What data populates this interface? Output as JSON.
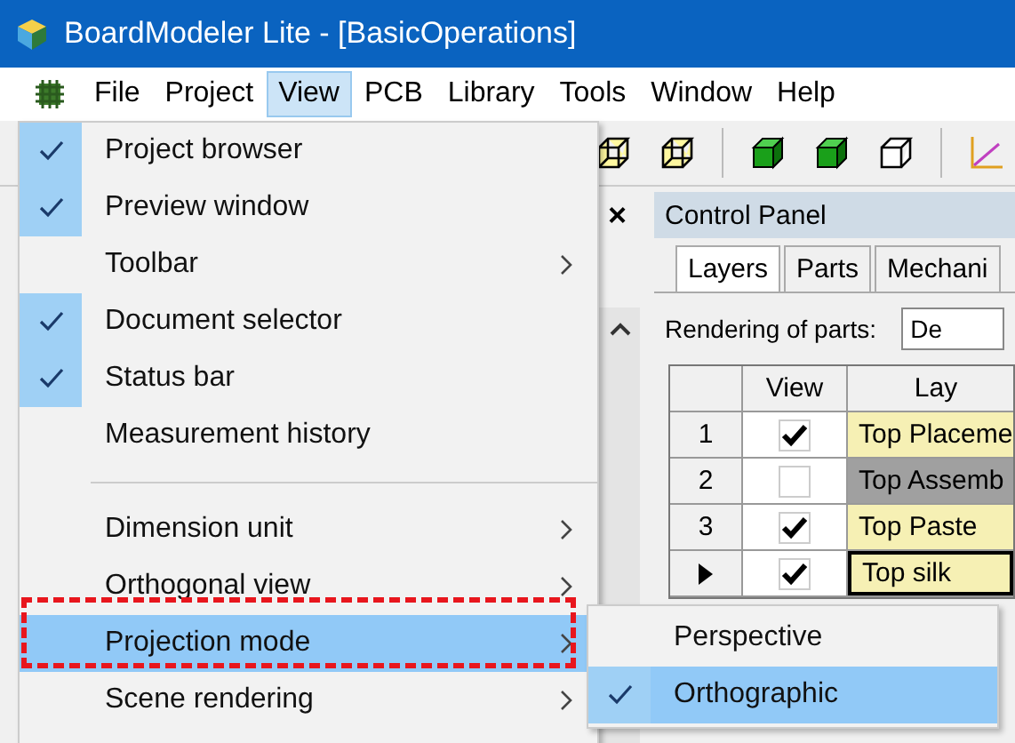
{
  "window": {
    "title": "BoardModeler Lite - [BasicOperations]"
  },
  "menu_bar": [
    {
      "label": "File",
      "selected": false
    },
    {
      "label": "Project",
      "selected": false
    },
    {
      "label": "View",
      "selected": true
    },
    {
      "label": "PCB",
      "selected": false
    },
    {
      "label": "Library",
      "selected": false
    },
    {
      "label": "Tools",
      "selected": false
    },
    {
      "label": "Window",
      "selected": false
    },
    {
      "label": "Help",
      "selected": false
    }
  ],
  "view_menu": [
    {
      "kind": "item",
      "label": "Project browser",
      "checked": true,
      "submenu": false,
      "selected": false
    },
    {
      "kind": "item",
      "label": "Preview window",
      "checked": true,
      "submenu": false,
      "selected": false
    },
    {
      "kind": "item",
      "label": "Toolbar",
      "checked": false,
      "submenu": true,
      "selected": false
    },
    {
      "kind": "item",
      "label": "Document selector",
      "checked": true,
      "submenu": false,
      "selected": false
    },
    {
      "kind": "item",
      "label": "Status bar",
      "checked": true,
      "submenu": false,
      "selected": false
    },
    {
      "kind": "item",
      "label": "Measurement history",
      "checked": false,
      "submenu": false,
      "selected": false
    },
    {
      "kind": "separator"
    },
    {
      "kind": "item",
      "label": "Dimension unit",
      "checked": false,
      "submenu": true,
      "selected": false
    },
    {
      "kind": "item",
      "label": "Orthogonal view",
      "checked": false,
      "submenu": true,
      "selected": false
    },
    {
      "kind": "item",
      "label": "Projection mode",
      "checked": false,
      "submenu": true,
      "selected": true
    },
    {
      "kind": "item",
      "label": "Scene rendering",
      "checked": false,
      "submenu": true,
      "selected": false
    }
  ],
  "projection_submenu": [
    {
      "label": "Perspective",
      "checked": false,
      "selected": false
    },
    {
      "label": "Orthographic",
      "checked": true,
      "selected": true
    }
  ],
  "control_panel": {
    "close": "×",
    "title": "Control Panel",
    "tabs": [
      {
        "label": "Layers",
        "selected": true
      },
      {
        "label": "Parts",
        "selected": false
      },
      {
        "label": "Mechani",
        "selected": false
      }
    ],
    "rendering_label": "Rendering of parts:",
    "rendering_value": "De",
    "table": {
      "columns": [
        "View",
        "Lay"
      ],
      "rows": [
        {
          "index": "1",
          "checked": true,
          "layer": "Top Placeme",
          "color": "#f6f0b4",
          "selected": false
        },
        {
          "index": "2",
          "checked": false,
          "layer": "Top Assemb",
          "color": "#a0a0a0",
          "selected": false
        },
        {
          "index": "3",
          "checked": true,
          "layer": "Top Paste",
          "color": "#f6f0b4",
          "selected": false
        },
        {
          "checked": true,
          "layer": "Top silk",
          "color": "#f6f0b4",
          "selected": true
        }
      ]
    }
  }
}
